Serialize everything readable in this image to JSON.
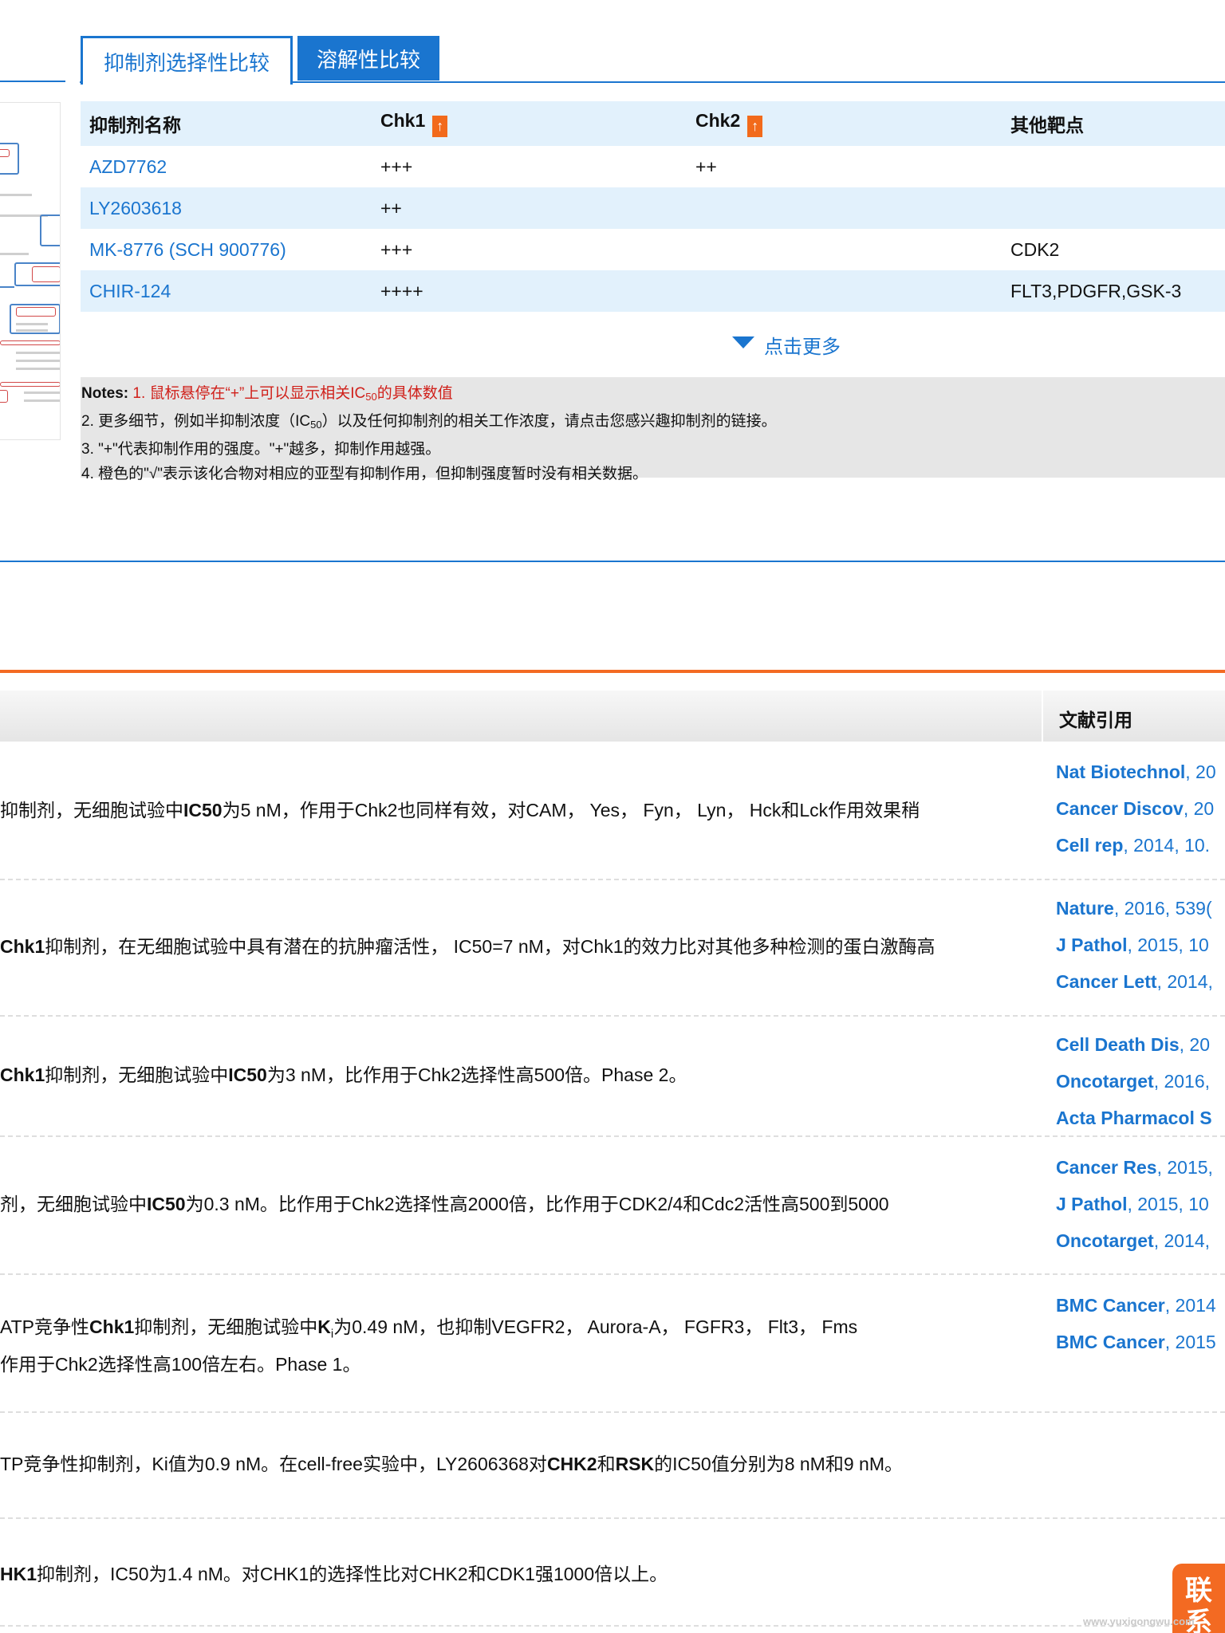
{
  "tabs": [
    {
      "label": "抑制剂选择性比较",
      "active": true
    },
    {
      "label": "溶解性比较",
      "active": false
    }
  ],
  "inhibitor_table": {
    "headers": [
      "抑制剂名称",
      "Chk1",
      "Chk2",
      "其他靶点"
    ],
    "sort_icon": "↑",
    "rows": [
      [
        "AZD7762",
        "+++",
        "++",
        ""
      ],
      [
        "LY2603618",
        "++",
        "",
        ""
      ],
      [
        "MK-8776 (SCH 900776)",
        "+++",
        "",
        "CDK2"
      ],
      [
        "CHIR-124",
        "++++",
        "",
        "FLT3,PDGFR,GSK-3"
      ]
    ]
  },
  "more_link": "点击更多",
  "notes": {
    "label": "Notes:",
    "n1_pre": "1. 鼠标悬停在“+”上可以显示相关IC",
    "n1_sub": "50",
    "n1_post": "的具体数值",
    "n2_pre": "2. 更多细节，例如半抑制浓度（IC",
    "n2_sub": "50",
    "n2_post": "）以及任何抑制剂的相关工作浓度，请点击您感兴趣抑制剂的链接。",
    "n3": "3. \"+\"代表抑制作用的强度。\"+\"越多，抑制作用越强。",
    "n4": "4. 橙色的\"√\"表示该化合物对相应的亚型有抑制作用，但抑制强度暂时没有相关数据。"
  },
  "bottom_table": {
    "ref_header": "文献引用",
    "rows": [
      {
        "desc": [
          [
            " 抑制剂，无细胞试验中",
            false
          ],
          [
            "IC50",
            true
          ],
          [
            "为5 nM，作用于Chk2也同样有效，对CAM， Yes， Fyn， Lyn， Hck和Lck作用效果稍",
            false
          ]
        ],
        "refs": [
          [
            "Nat Biotechnol",
            ", 20"
          ],
          [
            "Cancer Discov",
            ", 20"
          ],
          [
            "Cell rep",
            ", 2014, 10."
          ]
        ]
      },
      {
        "desc": [
          [
            "Chk1",
            true
          ],
          [
            "抑制剂，在无细胞试验中具有潜在的抗肿瘤活性， IC50=7 nM，对Chk1的效力比对其他多种检测的蛋白激酶高",
            false
          ]
        ],
        "refs": [
          [
            "Nature",
            ", 2016, 539("
          ],
          [
            "J Pathol",
            ", 2015, 10"
          ],
          [
            "Cancer Lett",
            ", 2014,"
          ]
        ]
      },
      {
        "desc": [
          [
            "Chk1",
            true
          ],
          [
            "抑制剂，无细胞试验中",
            false
          ],
          [
            "IC50",
            true
          ],
          [
            "为3 nM，比作用于Chk2选择性高500倍。Phase 2。",
            false
          ]
        ],
        "refs": [
          [
            "Cell Death Dis",
            ", 20"
          ],
          [
            "Oncotarget",
            ", 2016,"
          ],
          [
            "Acta Pharmacol S",
            ""
          ]
        ]
      },
      {
        "desc": [
          [
            "剂，无细胞试验中",
            false
          ],
          [
            "IC50",
            true
          ],
          [
            "为0.3 nM。比作用于Chk2选择性高2000倍，比作用于CDK2/4和Cdc2活性高500到5000",
            false
          ]
        ],
        "refs": [
          [
            "Cancer Res",
            ", 2015,"
          ],
          [
            "J Pathol",
            ", 2015, 10"
          ],
          [
            "Oncotarget",
            ", 2014,"
          ]
        ]
      },
      {
        "desc": [
          [
            " ATP竞争性",
            false
          ],
          [
            "Chk1",
            true
          ],
          [
            "抑制剂，无细胞试验中",
            false
          ],
          [
            "K",
            true
          ],
          [
            "i",
            "sub"
          ],
          [
            "为0.49 nM，也抑制VEGFR2， Aurora-A， FGFR3， Flt3， Fms",
            false
          ]
        ],
        "desc2": "作用于Chk2选择性高100倍左右。Phase 1。",
        "refs": [
          [
            "BMC Cancer",
            ", 2014"
          ],
          [
            "BMC Cancer",
            ", 2015"
          ]
        ]
      },
      {
        "desc": [
          [
            "TP竞争性抑制剂，Ki值为0.9 nM。在cell-free实验中，LY2606368对",
            false
          ],
          [
            "CHK2",
            true
          ],
          [
            "和",
            false
          ],
          [
            "RSK",
            true
          ],
          [
            "的IC50值分别为8 nM和9 nM。",
            false
          ]
        ],
        "refs": []
      },
      {
        "desc": [
          [
            "HK1",
            true
          ],
          [
            "抑制剂，IC50为1.4 nM。对CHK1的选择性比对CHK2和CDK1强1000倍以上。",
            false
          ]
        ],
        "refs": []
      }
    ]
  },
  "contact_badge": "联系我",
  "watermark": "www.yuxigongwu.com",
  "colors": {
    "blue": "#1a75cf",
    "orange": "#f36a22",
    "red": "#d0201a",
    "row_alt": "#e2f1fc"
  }
}
